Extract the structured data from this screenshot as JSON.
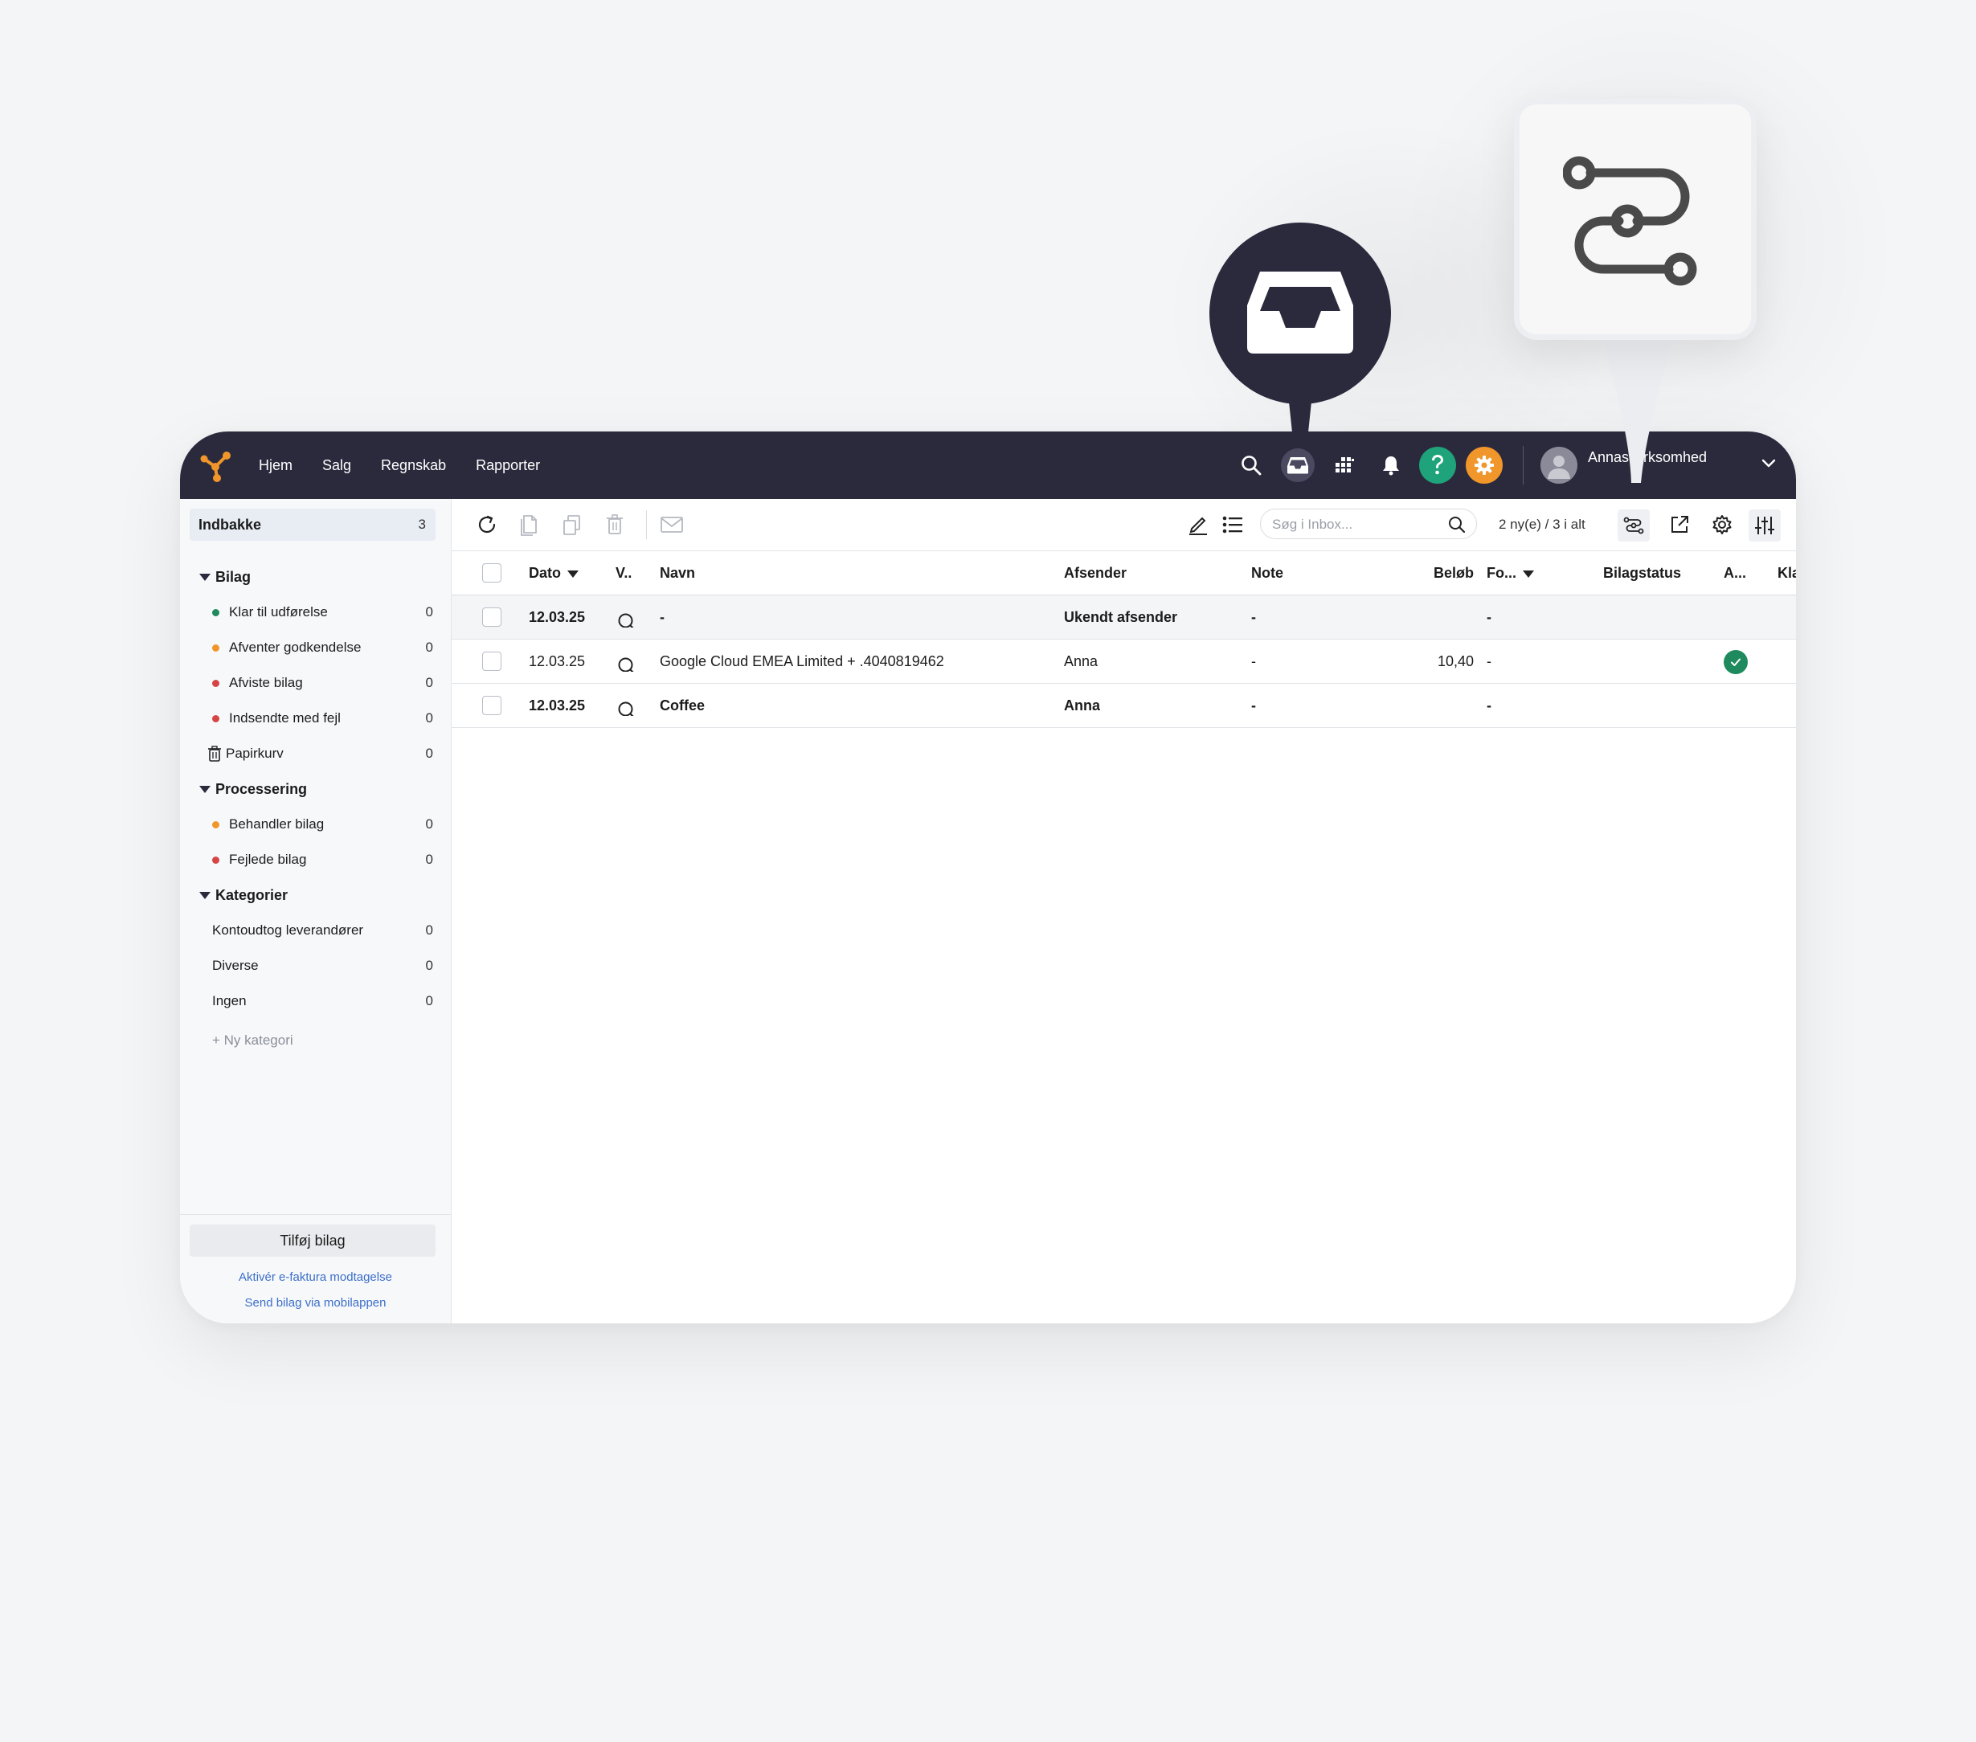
{
  "nav": {
    "items": [
      "Hjem",
      "Salg",
      "Regnskab",
      "Rapporter"
    ],
    "company_name": "Annas virksomhed",
    "icons": [
      "search-icon",
      "inbox-icon",
      "apps-grid-icon",
      "bell-icon",
      "help-icon",
      "gear-icon",
      "chevron-down-icon"
    ]
  },
  "sidebar": {
    "inbox": {
      "label": "Indbakke",
      "count": "3"
    },
    "groups": [
      {
        "label": "Bilag",
        "items": [
          {
            "label": "Klar til udførelse",
            "count": "0",
            "dot": "#1f8a5e"
          },
          {
            "label": "Afventer godkendelse",
            "count": "0",
            "dot": "#f0962a"
          },
          {
            "label": "Afviste bilag",
            "count": "0",
            "dot": "#d64545"
          },
          {
            "label": "Indsendte med fejl",
            "count": "0",
            "dot": "#d64545"
          },
          {
            "label": "Papirkurv",
            "count": "0",
            "icon": "trash-icon"
          }
        ]
      },
      {
        "label": "Processering",
        "items": [
          {
            "label": "Behandler bilag",
            "count": "0",
            "dot": "#f0962a"
          },
          {
            "label": "Fejlede bilag",
            "count": "0",
            "dot": "#d64545"
          }
        ]
      },
      {
        "label": "Kategorier",
        "items": [
          {
            "label": "Kontoudtog leverandører",
            "count": "0"
          },
          {
            "label": "Diverse",
            "count": "0"
          },
          {
            "label": "Ingen",
            "count": "0"
          }
        ]
      }
    ],
    "new_category": "+ Ny kategori",
    "add_button": "Tilføj bilag",
    "links": [
      "Aktivér e-faktura modtagelse",
      "Send bilag via mobilappen"
    ]
  },
  "toolbar": {
    "search_placeholder": "Søg i Inbox...",
    "counter": "2 ny(e) / 3 i alt"
  },
  "table": {
    "columns": [
      "Dato",
      "V..",
      "Navn",
      "Afsender",
      "Note",
      "Beløb",
      "Fo...",
      "Bilagstatus",
      "A...",
      "Klar til ..."
    ],
    "rows": [
      {
        "dato": "12.03.25",
        "navn": "-",
        "afsender": "Ukendt afsender",
        "note": "-",
        "belob": "",
        "fo": "-",
        "bold": true,
        "shaded": true,
        "approved": false
      },
      {
        "dato": "12.03.25",
        "navn": "Google Cloud EMEA Limited + .4040819462",
        "afsender": "Anna",
        "note": "-",
        "belob": "10,40",
        "fo": "-",
        "bold": false,
        "shaded": false,
        "approved": true
      },
      {
        "dato": "12.03.25",
        "navn": "Coffee",
        "afsender": "Anna",
        "note": "-",
        "belob": "",
        "fo": "-",
        "bold": true,
        "shaded": false,
        "approved": false
      }
    ]
  },
  "colors": {
    "navbar": "#2b2a3d",
    "accent_orange": "#f0962a",
    "accent_green": "#1fa37a",
    "link": "#3b6fc9"
  }
}
